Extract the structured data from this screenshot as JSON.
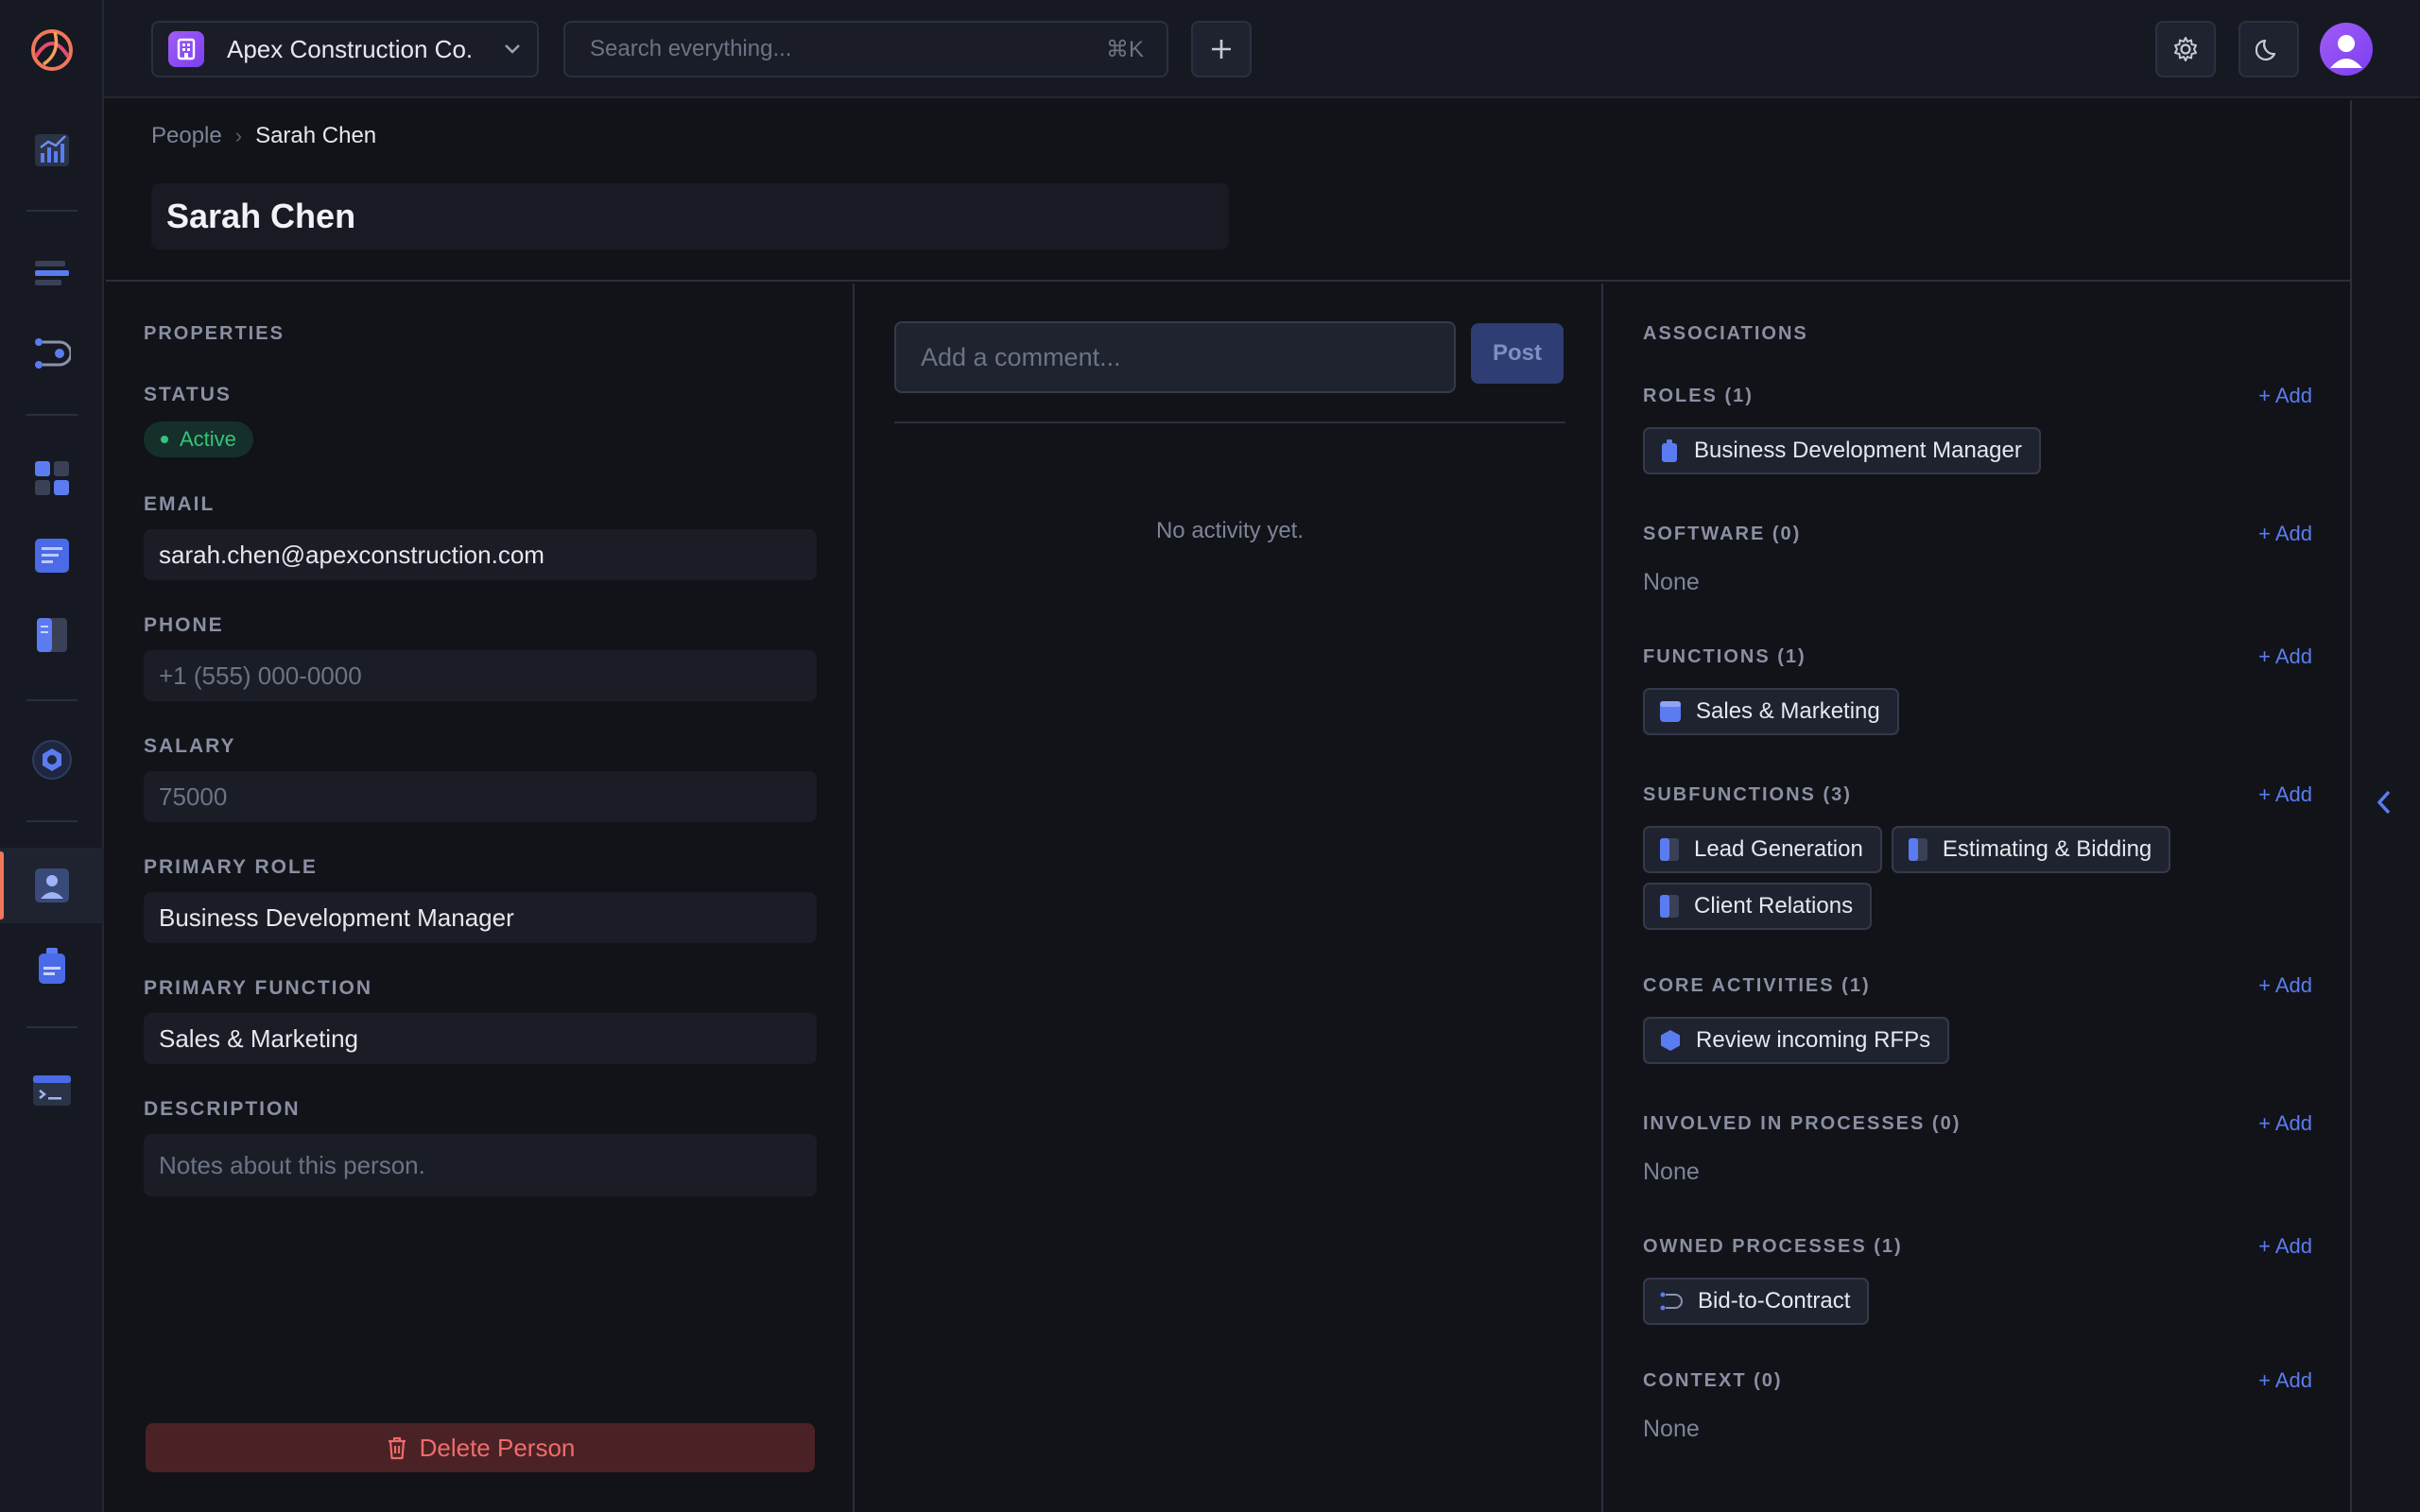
{
  "org": {
    "name": "Apex Construction Co."
  },
  "search": {
    "placeholder": "Search everything...",
    "shortcut": "⌘K"
  },
  "breadcrumb": {
    "parent": "People",
    "separator": "›",
    "current": "Sarah Chen"
  },
  "person": {
    "name": "Sarah Chen"
  },
  "properties": {
    "section_title": "PROPERTIES",
    "status_label": "STATUS",
    "status_value": "Active",
    "email_label": "EMAIL",
    "email_value": "sarah.chen@apexconstruction.com",
    "phone_label": "PHONE",
    "phone_placeholder": "+1 (555) 000-0000",
    "salary_label": "SALARY",
    "salary_placeholder": "75000",
    "primary_role_label": "PRIMARY ROLE",
    "primary_role_value": "Business Development Manager",
    "primary_function_label": "PRIMARY FUNCTION",
    "primary_function_value": "Sales & Marketing",
    "description_label": "DESCRIPTION",
    "description_placeholder": "Notes about this person.",
    "delete_label": "Delete Person"
  },
  "activity": {
    "comment_placeholder": "Add a comment...",
    "post_label": "Post",
    "empty_text": "No activity yet."
  },
  "associations": {
    "section_title": "ASSOCIATIONS",
    "add_label": "+ Add",
    "none_text": "None",
    "roles": {
      "label": "ROLES (1)",
      "items": [
        "Business Development Manager"
      ]
    },
    "software": {
      "label": "SOFTWARE (0)"
    },
    "functions": {
      "label": "FUNCTIONS (1)",
      "items": [
        "Sales & Marketing"
      ]
    },
    "subfunctions": {
      "label": "SUBFUNCTIONS (3)",
      "items": [
        "Lead Generation",
        "Estimating & Bidding",
        "Client Relations"
      ]
    },
    "core_activities": {
      "label": "CORE ACTIVITIES (1)",
      "items": [
        "Review incoming RFPs"
      ]
    },
    "involved_processes": {
      "label": "INVOLVED IN PROCESSES (0)"
    },
    "owned_processes": {
      "label": "OWNED PROCESSES (1)",
      "items": [
        "Bid-to-Contract"
      ]
    },
    "context": {
      "label": "CONTEXT (0)"
    }
  },
  "colors": {
    "accent": "#5b7cf0",
    "status_active": "#36c27a",
    "danger": "#ef6b6b",
    "brand_purple": "#8b4cf2",
    "nav_active_marker": "#f0775a"
  },
  "icons": {
    "rail": [
      "analytics-icon",
      "stack-icon",
      "process-icon",
      "functions-icon",
      "document-icon",
      "subfunction-icon",
      "activity-hex-icon",
      "person-icon",
      "role-badge-icon",
      "terminal-icon"
    ],
    "topbar": [
      "building-icon",
      "chevron-down-icon",
      "plus-icon",
      "gear-icon",
      "moon-icon",
      "user-avatar-icon"
    ]
  }
}
